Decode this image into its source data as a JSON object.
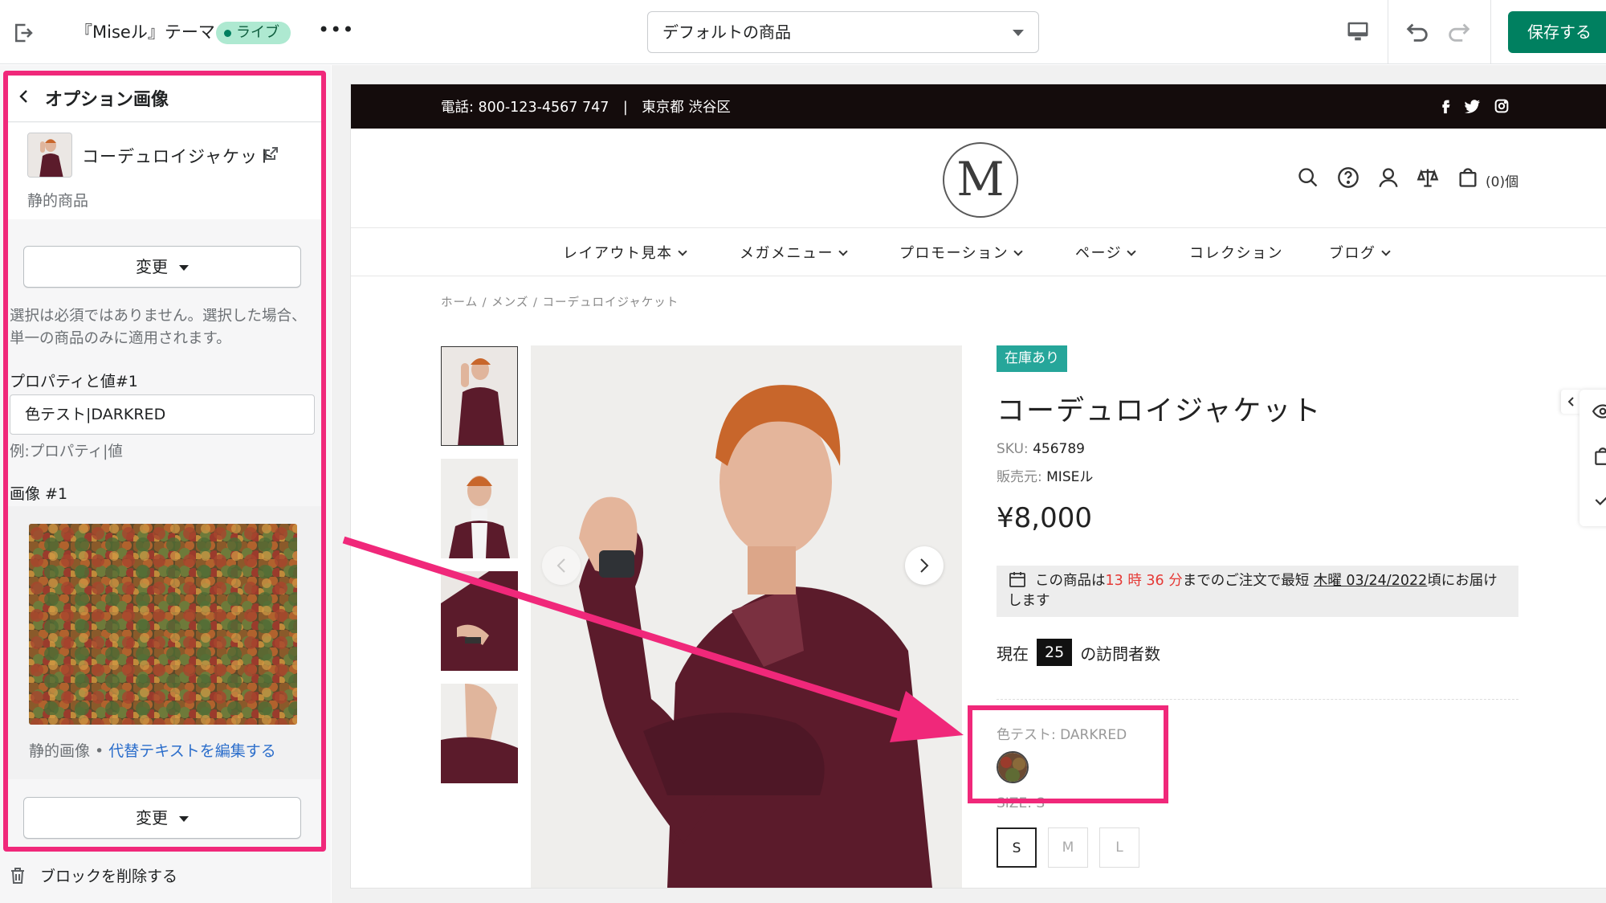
{
  "topbar": {
    "title": "『Miseル』テーマ",
    "live_badge": "ライブ",
    "template_select": "デフォルトの商品",
    "save_label": "保存する",
    "accent": "#008060"
  },
  "sidebar": {
    "header_title": "オプション画像",
    "product_name": "コーデュロイジャケット",
    "product_sub": "静的商品",
    "change_label": "変更",
    "help_text": "選択は必須ではありません。選択した場合、単一の商品のみに適用されます。",
    "property_label": "プロパティと値#1",
    "property_value": "色テスト|DARKRED",
    "property_hint": "例:プロパティ|値",
    "image_label": "画像 #1",
    "image_caption": "静的画像 • ",
    "alt_link": "代替テキストを編集する",
    "change_label_2": "変更",
    "delete_label": "ブロックを削除する",
    "highlight_color": "#f0287a"
  },
  "store": {
    "announcement": "電話: 800-123-4567 747　|　東京都 渋谷区",
    "cart_count": "(0)個",
    "nav": [
      "レイアウト見本",
      "メガメニュー",
      "プロモーション",
      "ページ",
      "コレクション",
      "ブログ"
    ],
    "breadcrumb": "ホーム / メンズ / コーデュロイジャケット",
    "stock_badge": "在庫あり",
    "product_title": "コーデュロイジャケット",
    "sku_label": "SKU:",
    "sku_value": "456789",
    "vendor_label": "販売元:",
    "vendor_value": "MISEル",
    "price": "¥8,000",
    "ship_prefix": "この商品は",
    "ship_time": "13 時 36 分",
    "ship_mid": "までのご注文で最短",
    "ship_date": "木曜 03/24/2022",
    "ship_suffix": "頃にお届けします",
    "visitors_prefix": "現在",
    "visitors_count": "25",
    "visitors_suffix": "の訪問者数",
    "color_option_label": "色テスト: DARKRED",
    "size_option_label": "SIZE: S",
    "sizes": [
      "S",
      "M",
      "L"
    ]
  }
}
